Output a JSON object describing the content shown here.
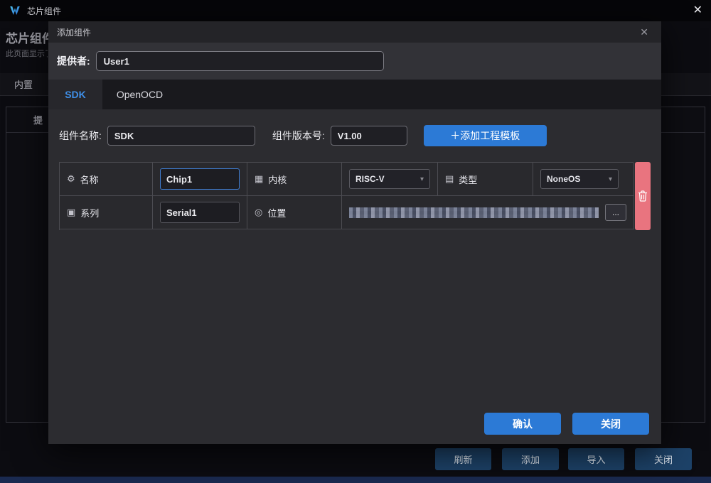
{
  "titlebar": {
    "title": "芯片组件",
    "close_icon": "✕"
  },
  "page": {
    "title": "芯片组件",
    "subtitle": "此页面显示了",
    "tab": "内置",
    "table_header_partial": "提",
    "buttons": {
      "refresh": "刷新",
      "add": "添加",
      "import": "导入",
      "close": "关闭"
    }
  },
  "modal": {
    "title": "添加组件",
    "close_icon": "✕",
    "provider": {
      "label": "提供者:",
      "value": "User1"
    },
    "tabs": {
      "sdk": "SDK",
      "openocd": "OpenOCD"
    },
    "form": {
      "name_label": "组件名称:",
      "name_value": "SDK",
      "version_label": "组件版本号:",
      "version_value": "V1.00",
      "add_template": "＋添加工程模板"
    },
    "table": {
      "name": {
        "label": "名称",
        "value": "Chip1"
      },
      "core": {
        "label": "内核",
        "value": "RISC-V"
      },
      "type": {
        "label": "类型",
        "value": "NoneOS"
      },
      "series": {
        "label": "系列",
        "value": "Serial1"
      },
      "location": {
        "label": "位置",
        "browse": "..."
      }
    },
    "footer": {
      "confirm": "确认",
      "close": "关闭"
    }
  },
  "icons": {
    "gear": "⚙",
    "core": "▦",
    "type": "▤",
    "series": "▣",
    "location": "◎",
    "chevron": "▾"
  },
  "colors": {
    "accent": "#2c7ad6",
    "tab_active": "#3f8fe8",
    "delete": "#e9747f"
  }
}
